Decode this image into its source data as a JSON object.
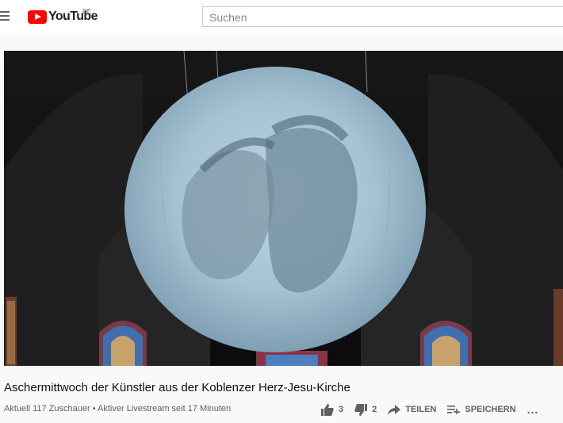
{
  "header": {
    "logo_text": "YouTube",
    "region": "DE",
    "search_placeholder": "Suchen"
  },
  "video": {
    "title": "Aschermittwoch der Künstler aus der Koblenzer Herz-Jesu-Kirche",
    "viewers": "Aktuell 117 Zuschauer",
    "separator": "•",
    "live_status": "Aktiver Livestream seit 17 Minuten"
  },
  "actions": {
    "likes": "3",
    "dislikes": "2",
    "share_label": "TEILEN",
    "save_label": "SPEICHERN",
    "more_label": "..."
  },
  "colors": {
    "brand_red": "#ff0000",
    "icon_gray": "#606060"
  }
}
